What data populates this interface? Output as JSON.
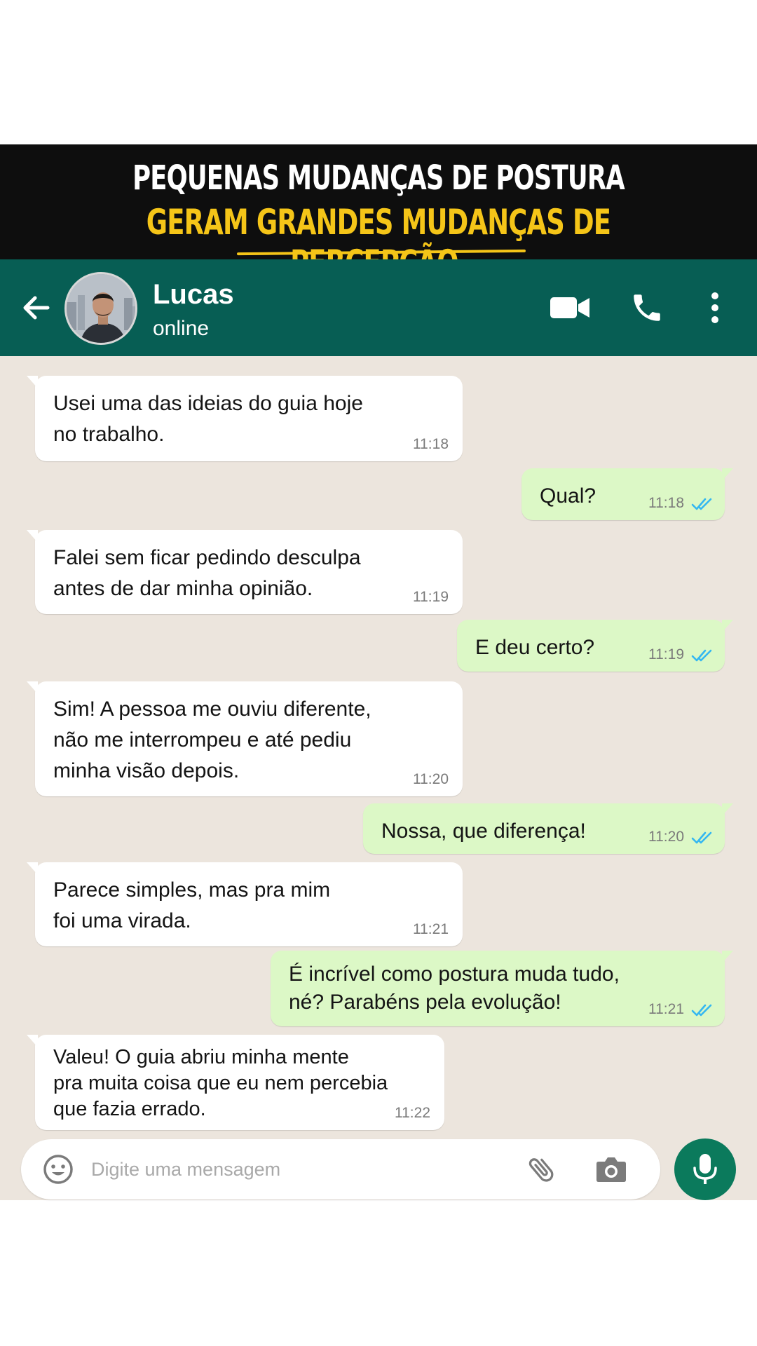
{
  "banner": {
    "line1": "PEQUENAS MUDANÇAS DE POSTURA",
    "line2": "GERAM GRANDES MUDANÇAS DE PERCEPÇÃO."
  },
  "header": {
    "contact_name": "Lucas",
    "status": "online",
    "icons": [
      "back-arrow-icon",
      "avatar",
      "video-camera-icon",
      "phone-icon",
      "more-vert-icon"
    ]
  },
  "messages": [
    {
      "direction": "in",
      "text": "Usei uma das ideias do guia hoje\nno trabalho.",
      "time": "11:18"
    },
    {
      "direction": "out",
      "text": "Qual?",
      "time": "11:18",
      "status": "read"
    },
    {
      "direction": "in",
      "text": "Falei sem ficar pedindo desculpa\nantes de dar minha opinião.",
      "time": "11:19"
    },
    {
      "direction": "out",
      "text": "E deu certo?",
      "time": "11:19",
      "status": "read"
    },
    {
      "direction": "in",
      "text": "Sim! A pessoa me ouviu diferente,\nnão me interrompeu e até pediu\nminha visão depois.",
      "time": "11:20"
    },
    {
      "direction": "out",
      "text": "Nossa, que diferença!",
      "time": "11:20",
      "status": "read"
    },
    {
      "direction": "in",
      "text": "Parece simples, mas pra mim\nfoi uma virada.",
      "time": "11:21"
    },
    {
      "direction": "out",
      "text": "É incrível como postura muda tudo,\nné? Parabéns pela evolução!",
      "time": "11:21",
      "status": "read"
    },
    {
      "direction": "in",
      "text": "Valeu! O guia abriu minha mente\npra muita coisa que eu nem percebia\nque fazia errado.",
      "time": "11:22"
    }
  ],
  "composer": {
    "placeholder": "Digite uma mensagem",
    "value": "",
    "icons": [
      "emoji-icon",
      "attach-icon",
      "camera-icon",
      "mic-icon"
    ]
  },
  "colors": {
    "banner_bg": "#0e0e0e",
    "banner_highlight": "#f5c518",
    "header_bg": "#075e54",
    "chat_bg": "#ece5dd",
    "incoming_bubble": "#ffffff",
    "outgoing_bubble": "#dcf8c6",
    "read_tick": "#34b7f1",
    "mic_button": "#0b7a5c"
  }
}
